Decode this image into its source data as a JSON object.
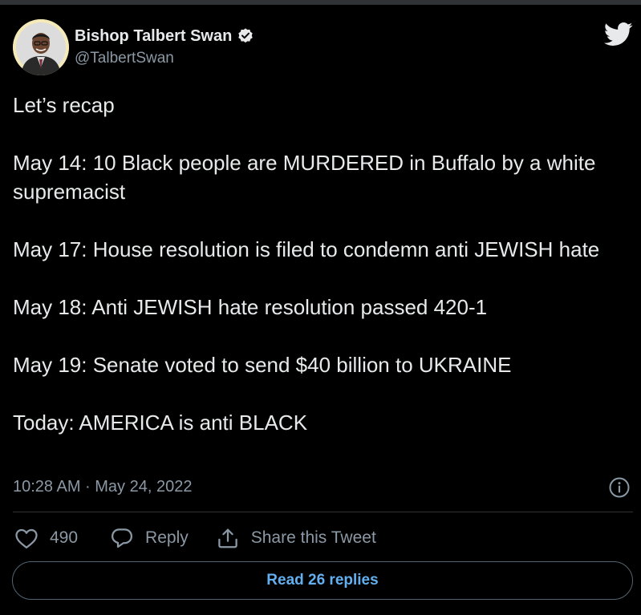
{
  "author": {
    "display_name": "Bishop Talbert Swan",
    "handle": "@TalbertSwan",
    "verified_icon": "verified-badge-icon",
    "avatar_icon": "profile-photo"
  },
  "brand": {
    "logo_icon": "twitter-bird-icon",
    "accent_color": "#1d9bf0",
    "link_color": "#63aff0"
  },
  "tweet": {
    "paragraphs": [
      "Let’s recap",
      "May 14: 10 Black people are MURDERED in Buffalo by a white supremacist",
      "May 17: House resolution is filed to condemn anti JEWISH hate",
      "May 18: Anti JEWISH hate resolution passed 420-1",
      "May 19: Senate voted to send $40 billion to UKRAINE",
      "Today: AMERICA is anti BLACK"
    ],
    "timestamp": "10:28 AM · May 24, 2022",
    "info_icon": "info-icon"
  },
  "actions": {
    "like_count": "490",
    "like_icon": "heart-icon",
    "reply_label": "Reply",
    "reply_icon": "speech-bubble-icon",
    "share_label": "Share this Tweet",
    "share_icon": "share-icon"
  },
  "footer": {
    "read_replies_label": "Read 26 replies"
  }
}
